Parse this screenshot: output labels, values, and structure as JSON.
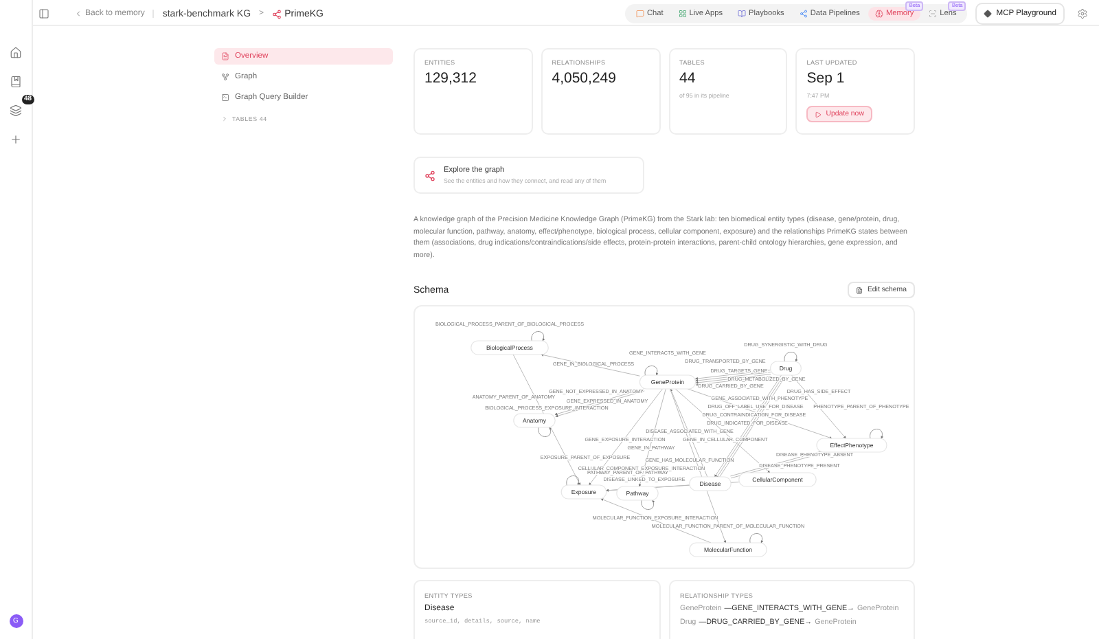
{
  "rail": {
    "badge": "48",
    "avatar": "G"
  },
  "topbar": {
    "back": "Back to memory",
    "breadcrumb": [
      "stark-benchmark KG",
      "PrimeKG"
    ],
    "separator": ">",
    "nav": [
      {
        "label": "Chat",
        "selected": false
      },
      {
        "label": "Live Apps",
        "selected": false
      },
      {
        "label": "Playbooks",
        "selected": false
      },
      {
        "label": "Data Pipelines",
        "selected": false
      },
      {
        "label": "Memory",
        "selected": true,
        "badge": "Beta"
      },
      {
        "label": "Lens",
        "selected": false,
        "badge": "Beta"
      }
    ],
    "playground": "MCP Playground"
  },
  "sidebar": {
    "items": [
      {
        "label": "Overview",
        "selected": true
      },
      {
        "label": "Graph",
        "selected": false
      },
      {
        "label": "Graph Query Builder",
        "selected": false
      }
    ],
    "section": {
      "label": "TABLES",
      "count": "44",
      "expanded": false
    }
  },
  "stats": [
    {
      "label": "ENTITIES",
      "value": "129,312"
    },
    {
      "label": "RELATIONSHIPS",
      "value": "4,050,249"
    },
    {
      "label": "TABLES",
      "value": "44",
      "sub": "of 95 in its pipeline"
    },
    {
      "label": "LAST UPDATED",
      "value": "Sep 1",
      "sub": "7:47 PM",
      "action": "Update now"
    }
  ],
  "explore": {
    "title": "Explore the graph",
    "subtitle": "See the entities and how they connect, and read any of them"
  },
  "description": "A knowledge graph of the Precision Medicine Knowledge Graph (PrimeKG) from the Stark lab: ten biomedical entity types (disease, gene/protein, drug, molecular function, pathway, anatomy, effect/phenotype, biological process, cellular component, exposure) and the relationships PrimeKG states between them (associations, drug indications/contraindications/side effects, protein-protein interactions, parent-child ontology hierarchies, gene expression, and more).",
  "schema": {
    "title": "Schema",
    "edit": "Edit schema",
    "nodes": [
      {
        "label": "BiologicalProcess"
      },
      {
        "label": "GeneProtein"
      },
      {
        "label": "Drug"
      },
      {
        "label": "Anatomy"
      },
      {
        "label": "EffectPhenotype"
      },
      {
        "label": "CellularComponent"
      },
      {
        "label": "Disease"
      },
      {
        "label": "Pathway"
      },
      {
        "label": "Exposure"
      },
      {
        "label": "MolecularFunction"
      }
    ],
    "edges": [
      {
        "label": "BIOLOGICAL_PROCESS_PARENT_OF_BIOLOGICAL_PROCESS"
      },
      {
        "label": "GENE_INTERACTS_WITH_GENE"
      },
      {
        "label": "DRUG_SYNERGISTIC_WITH_DRUG"
      },
      {
        "label": "GENE_IN_BIOLOGICAL_PROCESS"
      },
      {
        "label": "DRUG_TRANSPORTED_BY_GENE"
      },
      {
        "label": "DRUG_TARGETS_GENE"
      },
      {
        "label": "DRUG_METABOLIZED_BY_GENE"
      },
      {
        "label": "DRUG_CARRIED_BY_GENE"
      },
      {
        "label": "GENE_NOT_EXPRESSED_IN_ANATOMY"
      },
      {
        "label": "ANATOMY_PARENT_OF_ANATOMY"
      },
      {
        "label": "GENE_EXPRESSED_IN_ANATOMY"
      },
      {
        "label": "BIOLOGICAL_PROCESS_EXPOSURE_INTERACTION"
      },
      {
        "label": "DRUG_HAS_SIDE_EFFECT"
      },
      {
        "label": "GENE_ASSOCIATED_WITH_PHENOTYPE"
      },
      {
        "label": "DRUG_OFF_LABEL_USE_FOR_DISEASE"
      },
      {
        "label": "PHENOTYPE_PARENT_OF_PHENOTYPE"
      },
      {
        "label": "DRUG_CONTRAINDICATION_FOR_DISEASE"
      },
      {
        "label": "DRUG_INDICATED_FOR_DISEASE"
      },
      {
        "label": "DISEASE_ASSOCIATED_WITH_GENE"
      },
      {
        "label": "GENE_EXPOSURE_INTERACTION"
      },
      {
        "label": "GENE_IN_CELLULAR_COMPONENT"
      },
      {
        "label": "GENE_IN_PATHWAY"
      },
      {
        "label": "DISEASE_PHENOTYPE_ABSENT"
      },
      {
        "label": "GENE_HAS_MOLECULAR_FUNCTION"
      },
      {
        "label": "EXPOSURE_PARENT_OF_EXPOSURE"
      },
      {
        "label": "DISEASE_PHENOTYPE_PRESENT"
      },
      {
        "label": "CELLULAR_COMPONENT_EXPOSURE_INTERACTION"
      },
      {
        "label": "PATHWAY_PARENT_OF_PATHWAY"
      },
      {
        "label": "DISEASE_LINKED_TO_EXPOSURE"
      },
      {
        "label": "MOLECULAR_FUNCTION_EXPOSURE_INTERACTION"
      },
      {
        "label": "MOLECULAR_FUNCTION_PARENT_OF_MOLECULAR_FUNCTION"
      }
    ]
  },
  "entity_types": {
    "title": "ENTITY TYPES",
    "items": [
      {
        "name": "Disease",
        "fields": "source_id, details, source, name"
      }
    ]
  },
  "relationship_types": {
    "title": "RELATIONSHIP TYPES",
    "items": [
      {
        "from": "GeneProtein",
        "relation": "—GENE_INTERACTS_WITH_GENE→",
        "to": "GeneProtein"
      },
      {
        "from": "Drug",
        "relation": "—DRUG_CARRIED_BY_GENE→",
        "to": "GeneProtein"
      }
    ]
  }
}
